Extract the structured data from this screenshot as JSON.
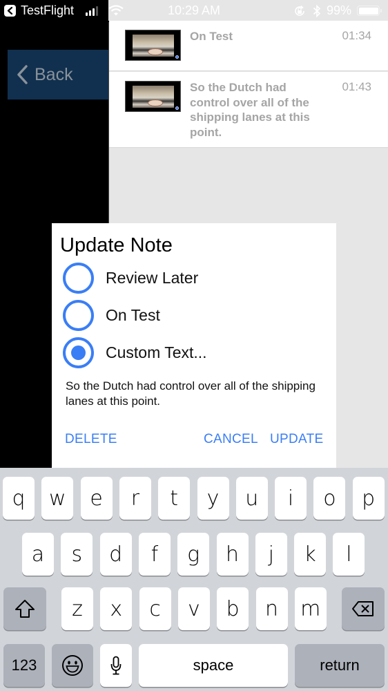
{
  "status_bar": {
    "back_app": "TestFlight",
    "time": "10:29 AM",
    "battery": "99%",
    "battery_level": 0.99,
    "signal_bars_active": 3,
    "signal_bars_total": 4,
    "icons": [
      "back-to-app-icon",
      "signal-icon",
      "wifi-icon",
      "rotation-lock-icon",
      "bluetooth-icon",
      "battery-icon"
    ]
  },
  "nav": {
    "back_label": "Back"
  },
  "notes": [
    {
      "text": "On Test",
      "time": "01:34"
    },
    {
      "text": "So the Dutch had control over all of the shipping lanes at this point.",
      "time": "01:43"
    }
  ],
  "dialog": {
    "title": "Update Note",
    "options": [
      {
        "label": "Review Later",
        "selected": false
      },
      {
        "label": "On Test",
        "selected": false
      },
      {
        "label": "Custom Text...",
        "selected": true
      }
    ],
    "custom_text_value": "So the Dutch had control over all of the shipping lanes at this point.",
    "buttons": {
      "delete": "DELETE",
      "cancel": "CANCEL",
      "update": "UPDATE"
    },
    "accent_color": "#3a7ef5"
  },
  "keyboard": {
    "row1": [
      "q",
      "w",
      "e",
      "r",
      "t",
      "y",
      "u",
      "i",
      "o",
      "p"
    ],
    "row2": [
      "a",
      "s",
      "d",
      "f",
      "g",
      "h",
      "j",
      "k",
      "l"
    ],
    "row3": [
      "z",
      "x",
      "c",
      "v",
      "b",
      "n",
      "m"
    ],
    "numbers_label": "123",
    "space_label": "space",
    "return_label": "return"
  }
}
